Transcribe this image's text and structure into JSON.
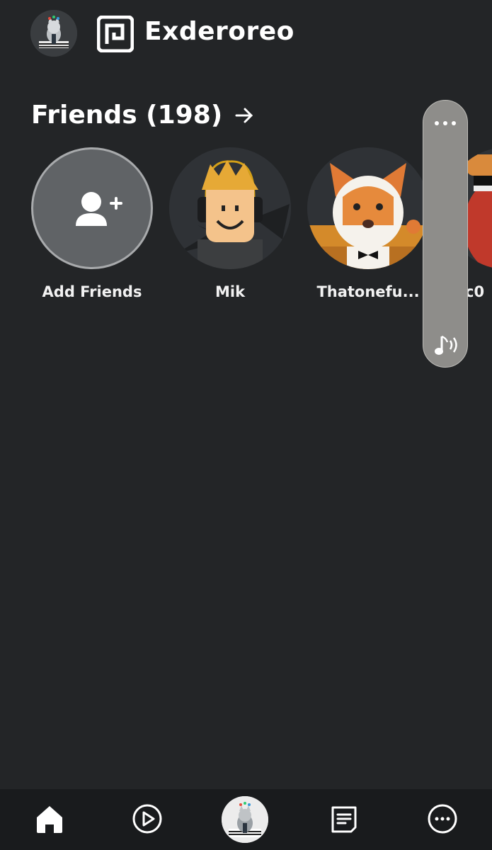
{
  "header": {
    "username": "Exderoreo"
  },
  "friends": {
    "title": "Friends (198)",
    "items": [
      {
        "label": "Add Friends"
      },
      {
        "label": "Mik"
      },
      {
        "label": "Thatonefu..."
      },
      {
        "label": "c0"
      }
    ]
  },
  "bottom_nav": {
    "items": [
      "home-icon",
      "play-icon",
      "avatar",
      "chat-icon",
      "more-icon"
    ]
  },
  "colors": {
    "background": "#232527",
    "nav_bg": "#191b1d",
    "panel": "#8e8d8a"
  }
}
